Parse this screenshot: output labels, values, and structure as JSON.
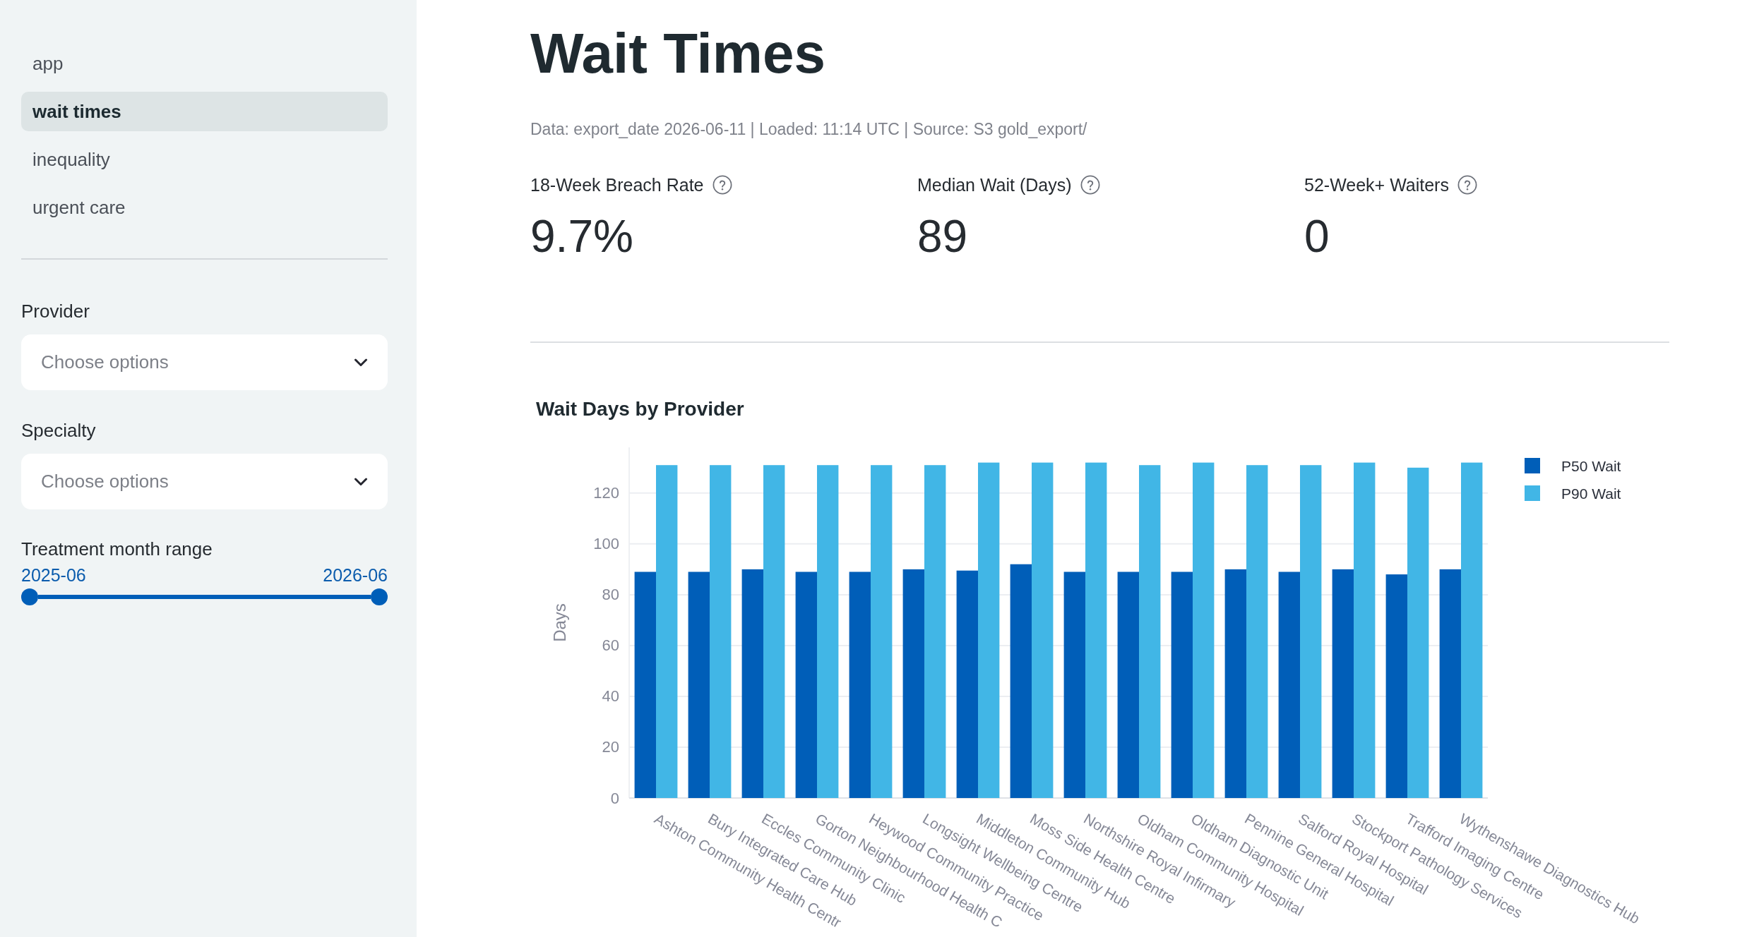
{
  "sidebar": {
    "nav_items": [
      {
        "label": "app",
        "selected": false
      },
      {
        "label": "wait times",
        "selected": true
      },
      {
        "label": "inequality",
        "selected": false
      },
      {
        "label": "urgent care",
        "selected": false
      }
    ],
    "filters": [
      {
        "label": "Provider",
        "placeholder": "Choose options"
      },
      {
        "label": "Specialty",
        "placeholder": "Choose options"
      }
    ],
    "range_slider": {
      "label": "Treatment month range",
      "start": "2025-06",
      "end": "2026-06",
      "level": 1
    }
  },
  "main": {
    "title": "Wait Times",
    "caption": "Data: export_date 2026-06-11 | Loaded: 11:14 UTC | Source: S3 gold_export/",
    "metrics": [
      {
        "label": "18-Week Breach Rate",
        "value": "9.7%"
      },
      {
        "label": "Median Wait (Days)",
        "value": "89"
      },
      {
        "label": "52-Week+ Waiters",
        "value": "0"
      }
    ],
    "chart": {
      "chart_data": {
        "type": "bar",
        "title": "Wait Days by Provider",
        "ylabel": "Days",
        "categories": [
          "Ashton Community Health Centr",
          "Bury Integrated Care Hub",
          "Eccles Community Clinic",
          "Gorton Neighbourhood Health C",
          "Heywood Community Practice",
          "Longsight Wellbeing Centre",
          "Middleton Community Hub",
          "Moss Side Health Centre",
          "Northshire Royal Infirmary",
          "Oldham Community Hospital",
          "Oldham Diagnostic Unit",
          "Pennine General Hospital",
          "Salford Royal Hospital",
          "Stockport Pathology Services",
          "Trafford Imaging Centre",
          "Wythenshawe Diagnostics Hub"
        ],
        "series": [
          {
            "name": "P50 Wait",
            "color": "#005eb8",
            "values": [
              89,
              89,
              90,
              89,
              89,
              90,
              89.5,
              92,
              89,
              89,
              89,
              90,
              89,
              90,
              88,
              90
            ]
          },
          {
            "name": "P90 Wait",
            "color": "#41b6e6",
            "values": [
              131,
              131,
              131,
              131,
              131,
              131,
              132,
              132,
              132,
              131,
              132,
              131,
              131,
              132,
              130,
              132
            ]
          }
        ],
        "ylim": [
          0,
          138
        ],
        "yticks": [
          {
            "value": 0,
            "label": "0"
          },
          20,
          40,
          60,
          80,
          100,
          120
        ],
        "grid": true,
        "legend": true
      }
    }
  }
}
